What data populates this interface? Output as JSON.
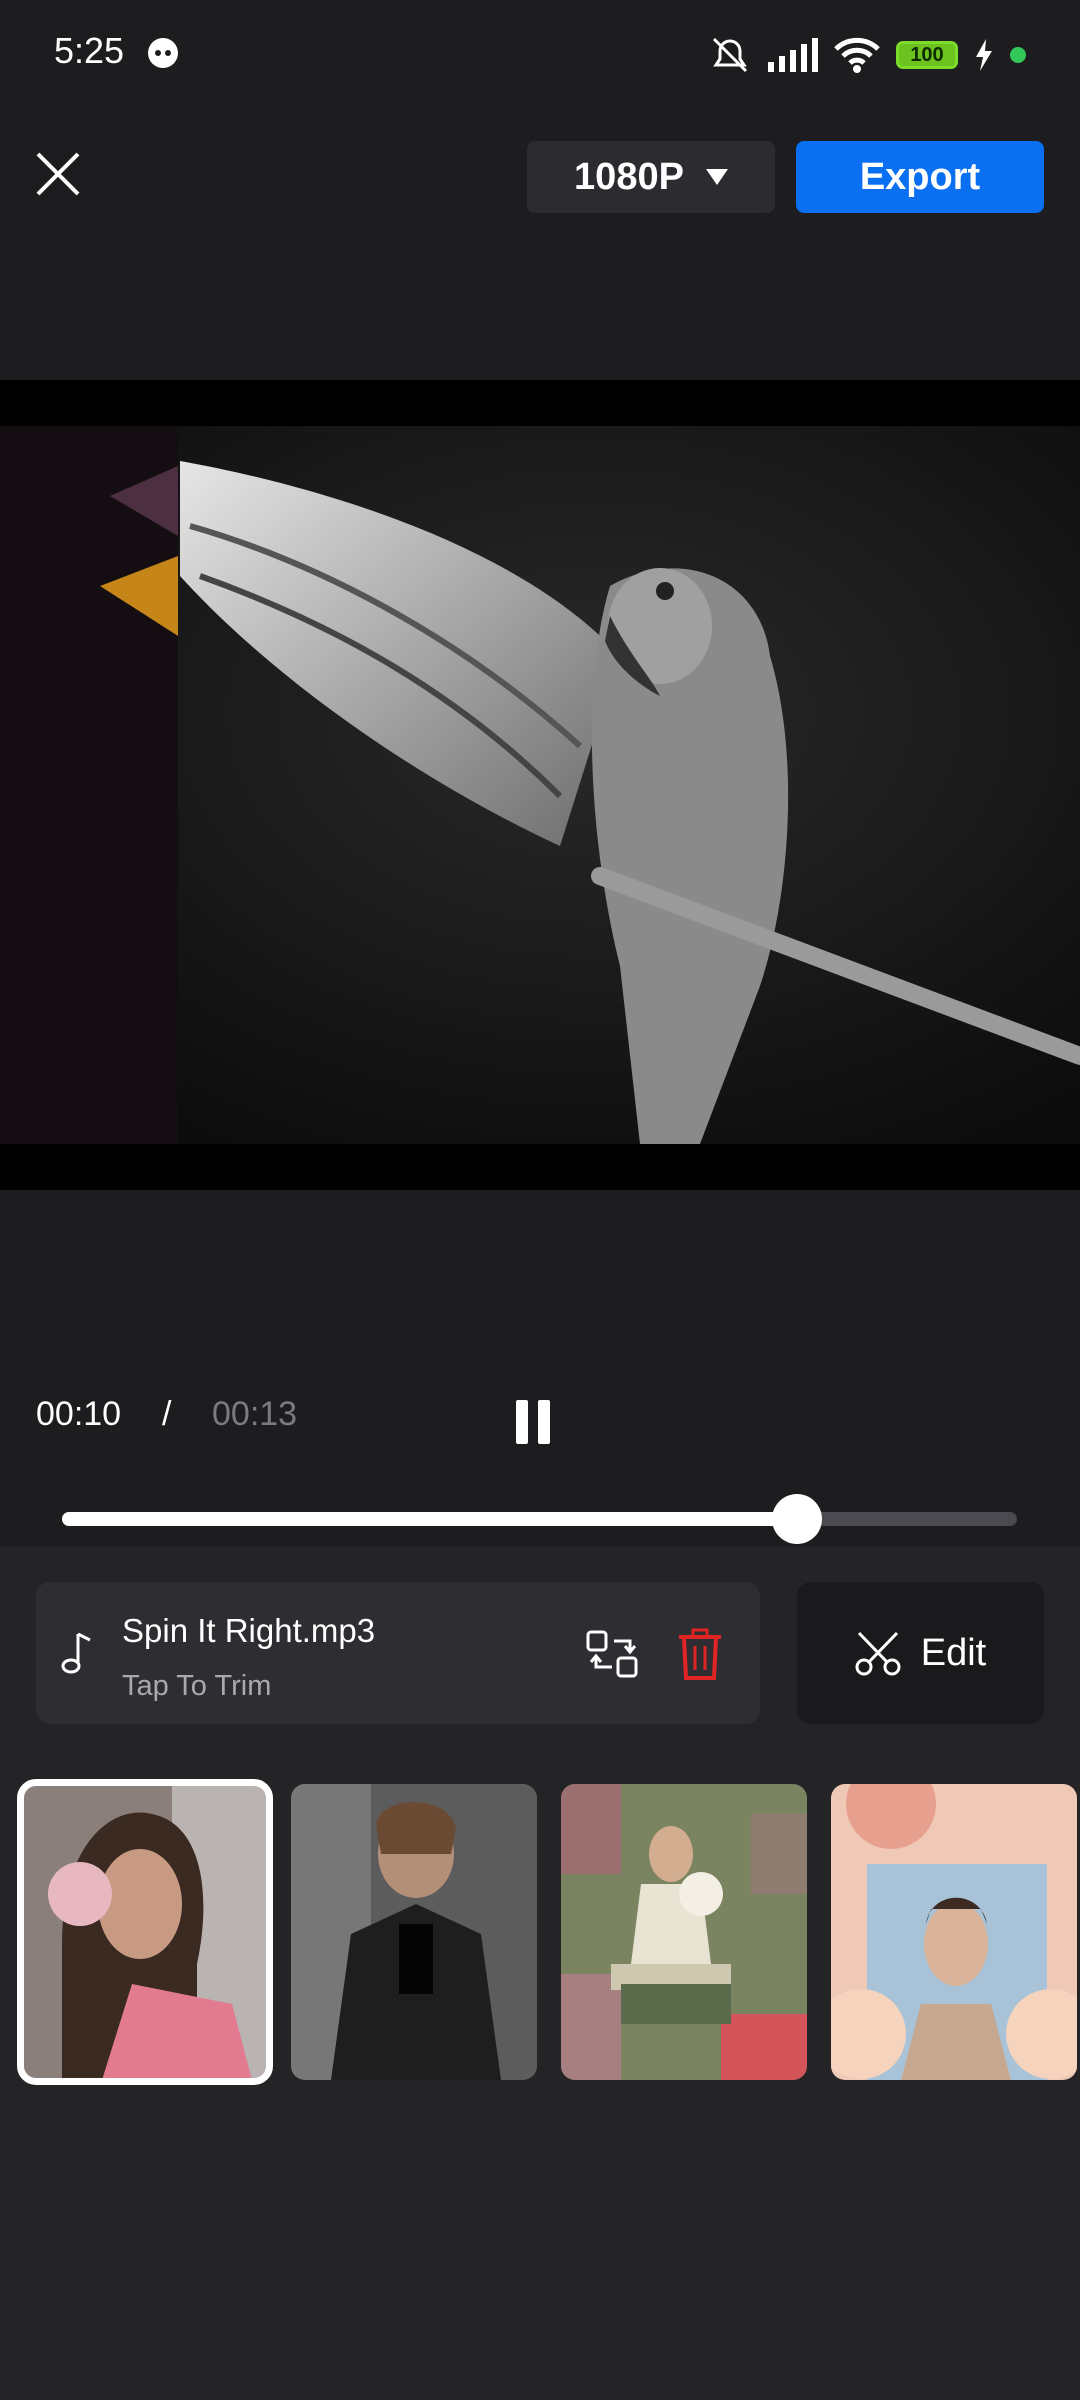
{
  "status_bar": {
    "time": "5:25",
    "battery": "100"
  },
  "toolbar": {
    "resolution": "1080P",
    "export_label": "Export"
  },
  "playback": {
    "current_time": "00:10",
    "separator": "/",
    "total_time": "00:13",
    "progress": 0.77
  },
  "audio": {
    "track_name": "Spin It Right.mp3",
    "hint": "Tap To Trim",
    "edit_label": "Edit"
  },
  "icons": {
    "close": "close-icon",
    "dropdown": "caret-down-icon",
    "pause": "pause-icon",
    "music": "music-note-icon",
    "replace": "replace-icon",
    "delete": "trash-icon",
    "edit": "scissors-icon"
  },
  "colors": {
    "accent": "#0a6ff0",
    "delete": "#e02424",
    "background": "#1d1d20"
  },
  "clips": [
    {
      "label": "clip-1",
      "selected": true
    },
    {
      "label": "clip-2",
      "selected": false
    },
    {
      "label": "clip-3",
      "selected": false
    },
    {
      "label": "clip-4",
      "selected": false
    }
  ]
}
